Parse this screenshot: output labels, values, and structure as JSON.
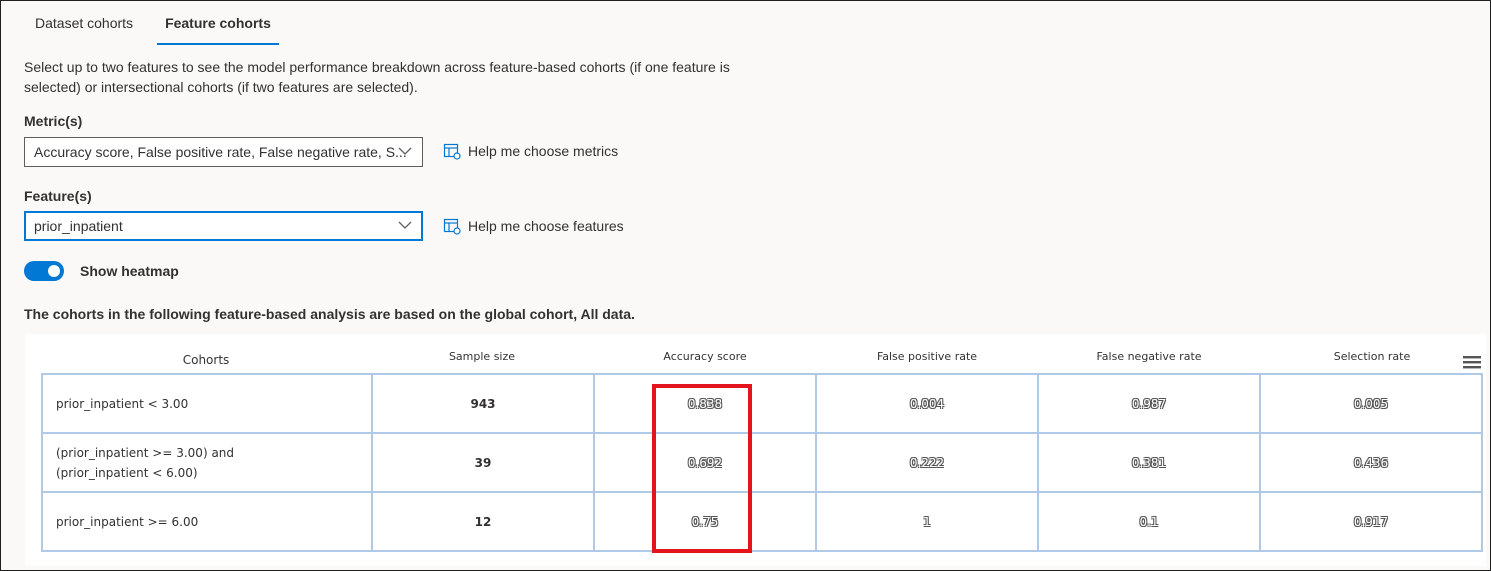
{
  "tabs": [
    {
      "label": "Dataset cohorts",
      "active": false
    },
    {
      "label": "Feature cohorts",
      "active": true
    }
  ],
  "intro": "Select up to two features to see the model performance breakdown across feature-based cohorts (if one feature is selected) or intersectional cohorts (if two features are selected).",
  "metrics": {
    "label": "Metric(s)",
    "value": "Accuracy score, False positive rate, False negative rate, S...",
    "help": "Help me choose metrics"
  },
  "features": {
    "label": "Feature(s)",
    "value": "prior_inpatient",
    "help": "Help me choose features"
  },
  "heatmap": {
    "label": "Show heatmap",
    "on": true
  },
  "note": "The cohorts in the following feature-based analysis are based on the global cohort, All data.",
  "table": {
    "headers": [
      "Cohorts",
      "Sample size",
      "Accuracy score",
      "False positive rate",
      "False negative rate",
      "Selection rate"
    ],
    "rows": [
      {
        "cohort": "prior_inpatient < 3.00",
        "size": "943",
        "accuracy": "0.838",
        "fpr": "0.004",
        "fnr": "0.987",
        "selection": "0.005"
      },
      {
        "cohort": "(prior_inpatient >= 3.00) and (prior_inpatient < 6.00)",
        "size": "39",
        "accuracy": "0.692",
        "fpr": "0.222",
        "fnr": "0.381",
        "selection": "0.436"
      },
      {
        "cohort": "prior_inpatient >= 6.00",
        "size": "12",
        "accuracy": "0.75",
        "fpr": "1",
        "fnr": "0.1",
        "selection": "0.917"
      }
    ]
  },
  "colors": {
    "accent": "#0078d4",
    "highlight": "#e3141c",
    "cell_border": "#b0c9e6"
  },
  "icons": [
    "chevron-down-icon",
    "help-table-icon",
    "hamburger-menu-icon"
  ]
}
